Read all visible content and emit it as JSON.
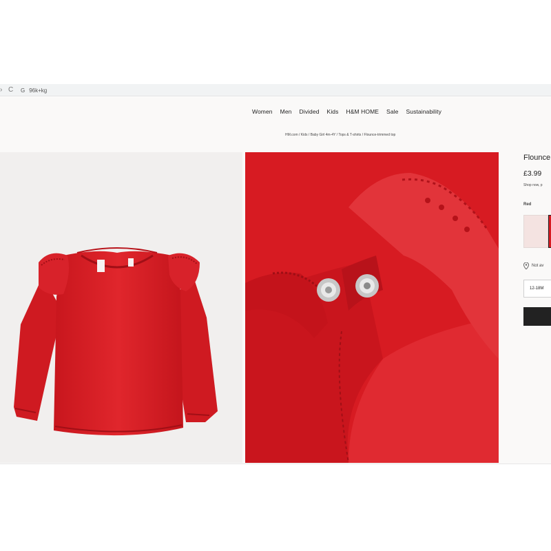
{
  "browser": {
    "back_icon": "back-arrow-icon",
    "reload_glyph": "C",
    "google_glyph": "G",
    "address_text": "96k+kg"
  },
  "nav": {
    "items": [
      "Women",
      "Men",
      "Divided",
      "Kids",
      "H&M HOME",
      "Sale",
      "Sustainability"
    ]
  },
  "breadcrumb": "HM.com / Kids / Baby Girl 4m-4Y / Tops & T-shirts / Flounce-trimmed top",
  "product": {
    "title": "Flounce",
    "price": "£3.99",
    "shop_note": "Shop now, p",
    "color_label": "Red",
    "availability": "Not av",
    "size": "12-18M"
  },
  "colors": {
    "red": "#d81b22",
    "dark_red": "#a10f16",
    "swatch_pink": "#f4e3e1",
    "button_black": "#222222"
  }
}
